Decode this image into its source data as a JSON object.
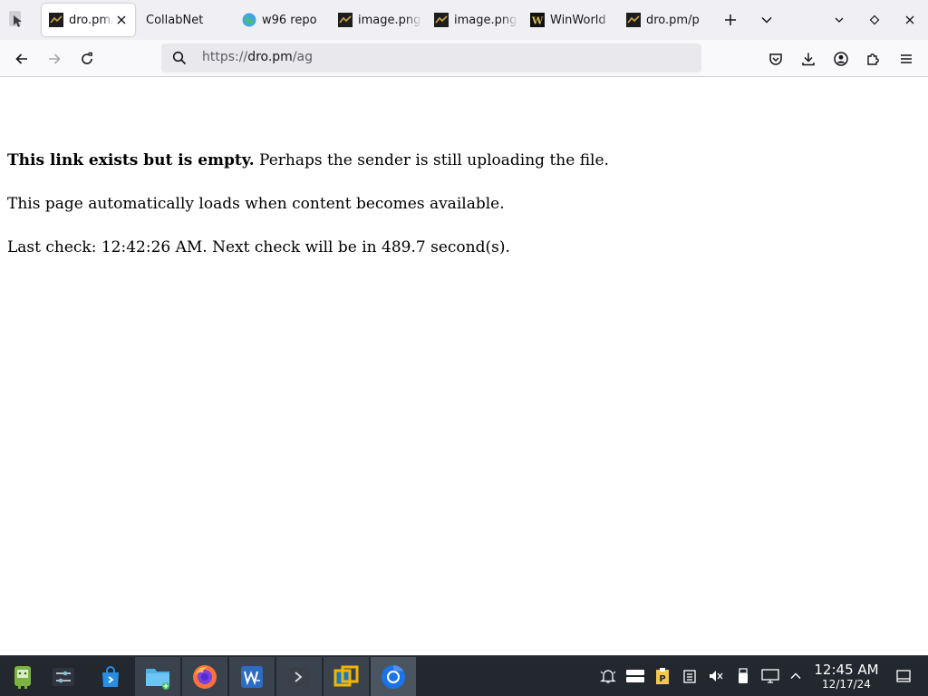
{
  "browser": {
    "tabs": [
      {
        "label": "dro.pm/ag",
        "favicon": "dro-pm-icon",
        "active": true
      },
      {
        "label": "CollabNet",
        "favicon": "",
        "active": false
      },
      {
        "label": "w96 repo",
        "favicon": "globe-icon",
        "active": false
      },
      {
        "label": "image.png",
        "favicon": "dro-pm-icon",
        "active": false
      },
      {
        "label": "image.png",
        "favicon": "dro-pm-icon",
        "active": false
      },
      {
        "label": "WinWorld",
        "favicon": "winworld-icon",
        "active": false
      },
      {
        "label": "dro.pm/p",
        "favicon": "dro-pm-icon",
        "active": false
      }
    ],
    "url": {
      "prefix": "https://",
      "domain": "dro.pm",
      "path": "/ag"
    }
  },
  "page": {
    "line1_bold": "This link exists but is empty.",
    "line1_rest": " Perhaps the sender is still uploading the file.",
    "line2": "This page automatically loads when content becomes available.",
    "line3": "Last check: 12:42:26 AM. Next check will be in 489.7 second(s)."
  },
  "taskbar": {
    "apps": [
      "android-app-icon",
      "settings-sliders-icon",
      "store-icon",
      "file-manager-icon",
      "firefox-icon",
      "wps-writer-icon",
      "terminal-icon",
      "virtualbox-icon",
      "chromium-icon"
    ],
    "tray": [
      "notification-bell-icon",
      "task-manager-icon",
      "clipboard-icon",
      "storage-icon",
      "volume-muted-icon",
      "usb-icon",
      "network-icon",
      "tray-expand-icon"
    ],
    "clock": {
      "time": "12:45 AM",
      "date": "12/17/24"
    }
  },
  "colors": {
    "tabstrip_bg": "#f0f0f4",
    "navbar_bg": "#f9f9fb",
    "urlbar_bg": "#e9e9ed",
    "taskbar_bg": "#23282e"
  }
}
